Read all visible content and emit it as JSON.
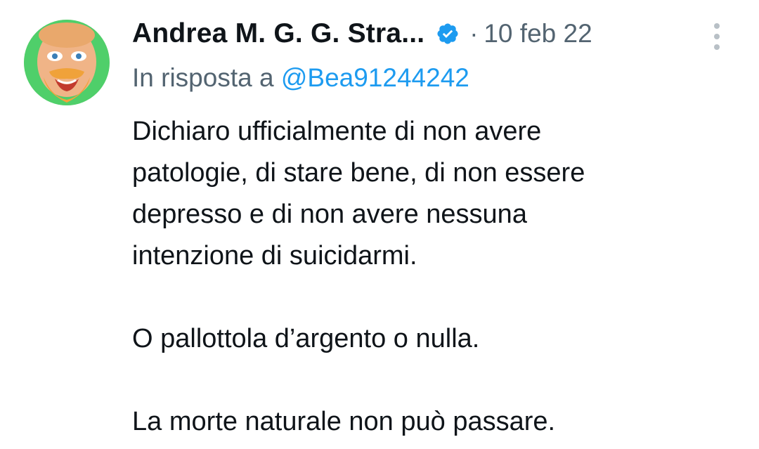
{
  "tweet": {
    "author_name": "Andrea M. G. G. Stra...",
    "separator": "·",
    "date": "10 feb 22",
    "reply_prefix": "In risposta a",
    "reply_handle": "@Bea91244242",
    "lines": [
      "Dichiaro ufficialmente di non avere",
      "patologie, di stare bene, di non essere",
      "depresso e di non avere nessuna",
      "intenzione di suicidarmi."
    ],
    "paragraph2": "O pallottola d’argento o nulla.",
    "paragraph3": "La morte naturale non può passare."
  },
  "icons": {
    "verified": "verified-badge-icon",
    "more": "more-options-icon"
  },
  "colors": {
    "text": "#0f1419",
    "secondary": "#536471",
    "accent": "#1d9bf0"
  }
}
